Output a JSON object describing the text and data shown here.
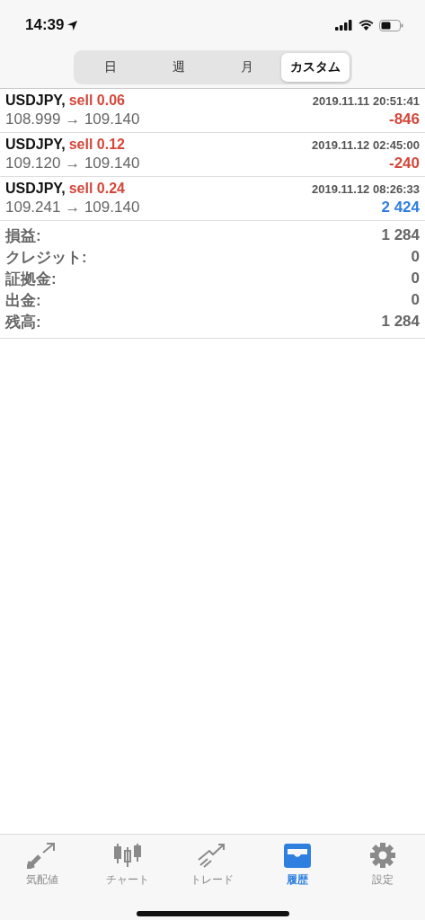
{
  "status_bar": {
    "time": "14:39"
  },
  "segments": [
    {
      "label": "日",
      "selected": false
    },
    {
      "label": "週",
      "selected": false
    },
    {
      "label": "月",
      "selected": false
    },
    {
      "label": "カスタム",
      "selected": true
    }
  ],
  "trades": [
    {
      "symbol": "USDJPY,",
      "order": "sell 0.06",
      "time": "2019.11.11 20:51:41",
      "prices": "108.999 → 109.140",
      "profit": "-846",
      "color": "#d4473a"
    },
    {
      "symbol": "USDJPY,",
      "order": "sell 0.12",
      "time": "2019.11.12 02:45:00",
      "prices": "109.120 → 109.140",
      "profit": "-240",
      "color": "#d4473a"
    },
    {
      "symbol": "USDJPY,",
      "order": "sell 0.24",
      "time": "2019.11.12 08:26:33",
      "prices": "109.241 → 109.140",
      "profit": "2 424",
      "color": "#2f7fe0"
    }
  ],
  "summary": [
    {
      "label": "損益:",
      "value": "1 284"
    },
    {
      "label": "クレジット:",
      "value": "0"
    },
    {
      "label": "証拠金:",
      "value": "0"
    },
    {
      "label": "出金:",
      "value": "0"
    },
    {
      "label": "残高:",
      "value": "1 284"
    }
  ],
  "tab_bar": [
    {
      "label": "気配値",
      "selected": false
    },
    {
      "label": "チャート",
      "selected": false
    },
    {
      "label": "トレード",
      "selected": false
    },
    {
      "label": "履歴",
      "selected": true
    },
    {
      "label": "設定",
      "selected": false
    }
  ]
}
